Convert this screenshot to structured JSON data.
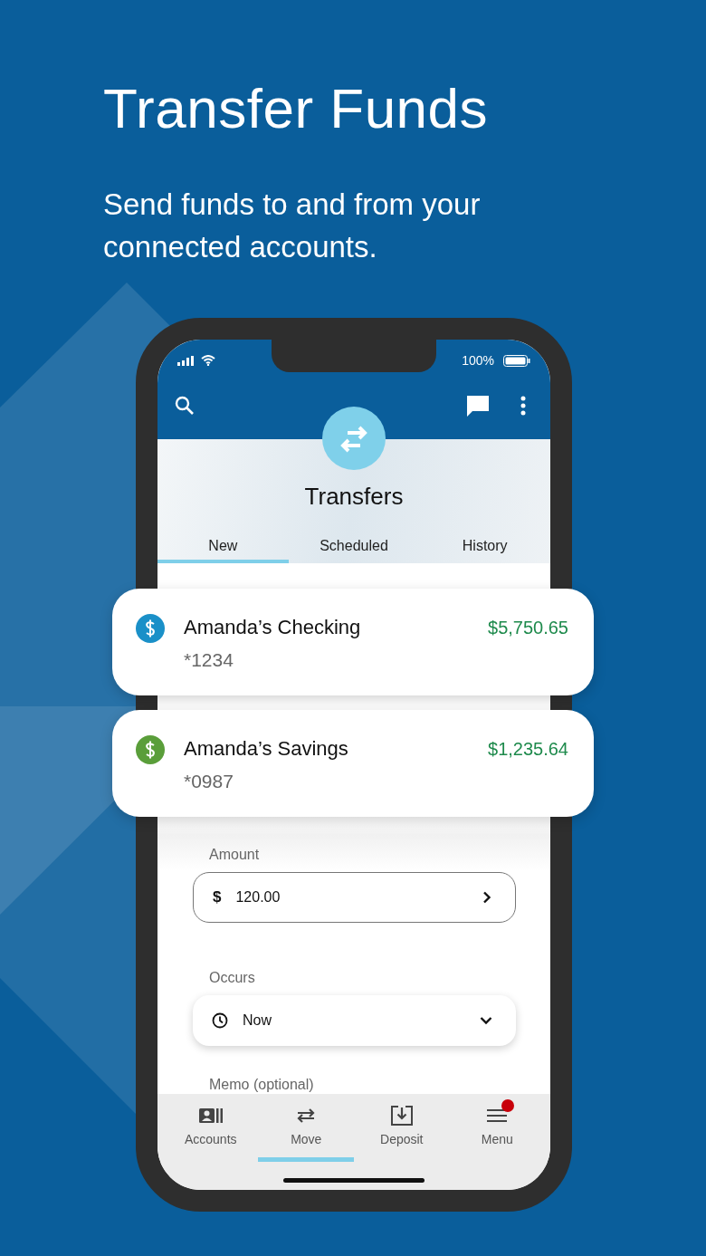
{
  "heading": "Transfer Funds",
  "subheading": "Send funds to and from your connected accounts.",
  "status_bar": {
    "battery": "100%"
  },
  "screen_title": "Transfers",
  "tabs": [
    {
      "label": "New",
      "selected": true
    },
    {
      "label": "Scheduled",
      "selected": false
    },
    {
      "label": "History",
      "selected": false
    }
  ],
  "accounts": [
    {
      "name": "Amanda’s Checking",
      "number": "*1234",
      "balance": "$5,750.65",
      "color": "#1a90c8"
    },
    {
      "name": "Amanda’s Savings",
      "number": "*0987",
      "balance": "$1,235.64",
      "color": "#5a9e3a"
    }
  ],
  "amount": {
    "label": "Amount",
    "currency": "$",
    "value": "120.00"
  },
  "occurs": {
    "label": "Occurs",
    "value": "Now"
  },
  "memo": {
    "label": "Memo (optional)"
  },
  "nav": [
    {
      "kind": "accounts",
      "label": "Accounts",
      "selected": false
    },
    {
      "kind": "move",
      "label": "Move",
      "selected": true
    },
    {
      "kind": "deposit",
      "label": "Deposit",
      "selected": false
    },
    {
      "kind": "menu",
      "label": "Menu",
      "selected": false,
      "badge": true
    }
  ]
}
